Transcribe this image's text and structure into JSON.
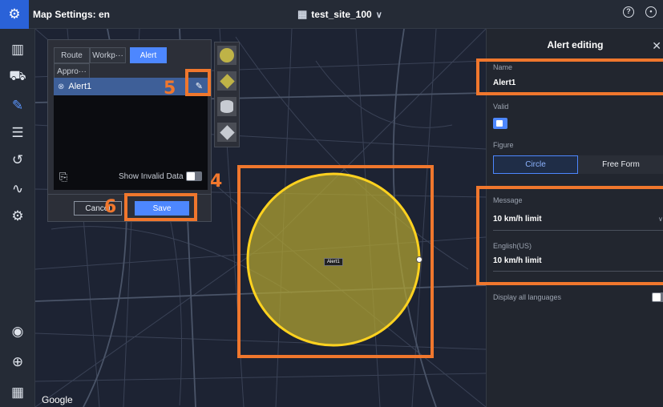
{
  "header": {
    "app_title": "Map Settings: en",
    "site_name": "test_site_100",
    "icons": [
      "logo-icon",
      "qr-icon",
      "chevron-down-icon",
      "help-icon",
      "account-icon"
    ]
  },
  "sidebar": {
    "items": [
      {
        "name": "map-icon"
      },
      {
        "name": "vehicle-icon"
      },
      {
        "name": "route-edit-icon",
        "active": true
      },
      {
        "name": "list-icon"
      },
      {
        "name": "history-icon"
      },
      {
        "name": "path-icon"
      },
      {
        "name": "settings-icon"
      },
      {
        "name": "location-icon"
      },
      {
        "name": "globe-icon"
      },
      {
        "name": "apps-grid-icon"
      }
    ]
  },
  "map": {
    "attribution": "Google",
    "circle_label": "Alert1",
    "circle_fill": "#b3a530",
    "circle_stroke": "#ffd21f"
  },
  "editor_panel": {
    "tabs": [
      {
        "label": "Route",
        "active": false
      },
      {
        "label": "Workp···",
        "active": false
      },
      {
        "label": "Alert",
        "active": true
      },
      {
        "label": "Appro···",
        "active": false
      }
    ],
    "list_items": [
      "Alert1"
    ],
    "show_invalid_label": "Show Invalid Data",
    "show_invalid_on": false,
    "cancel_label": "Cancel",
    "save_label": "Save"
  },
  "shape_palette": [
    "circle-shape-icon",
    "polygon-shape-icon",
    "cylinder-shape-icon",
    "layers-icon"
  ],
  "alert_editing": {
    "title": "Alert editing",
    "name_label": "Name",
    "name_value": "Alert1",
    "valid_label": "Valid",
    "valid_checked": true,
    "figure_label": "Figure",
    "figure_options": [
      "Circle",
      "Free Form"
    ],
    "figure_selected": "Circle",
    "message_label": "Message",
    "message_value": "10 km/h limit",
    "english_label": "English(US)",
    "english_value": "10 km/h limit",
    "display_all_label": "Display all languages",
    "display_all_on": false
  },
  "annotations": {
    "step_4": "4",
    "step_5": "5",
    "step_6": "6",
    "color": "#f0772d"
  },
  "colors": {
    "accent": "#4d87ff",
    "annotation": "#f0772d"
  }
}
